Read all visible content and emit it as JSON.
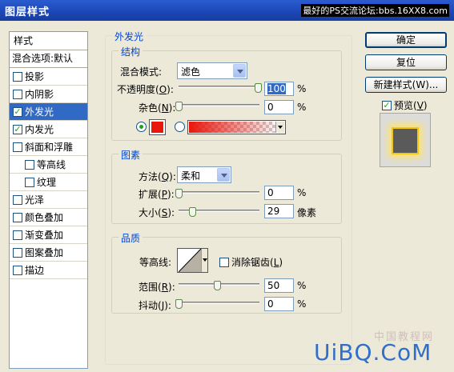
{
  "window": {
    "title": "图层样式",
    "watermark": "最好的PS交流论坛:bbs.16XX8.com"
  },
  "style_list": {
    "header": "样式",
    "blend_options": "混合选项:默认",
    "items": [
      {
        "label": "投影",
        "checked": false
      },
      {
        "label": "内阴影",
        "checked": false
      },
      {
        "label": "外发光",
        "checked": true,
        "selected": true
      },
      {
        "label": "内发光",
        "checked": true
      },
      {
        "label": "斜面和浮雕",
        "checked": false
      },
      {
        "label": "等高线",
        "checked": false,
        "sub": true
      },
      {
        "label": "纹理",
        "checked": false,
        "sub": true
      },
      {
        "label": "光泽",
        "checked": false
      },
      {
        "label": "颜色叠加",
        "checked": false
      },
      {
        "label": "渐变叠加",
        "checked": false
      },
      {
        "label": "图案叠加",
        "checked": false
      },
      {
        "label": "描边",
        "checked": false
      }
    ]
  },
  "panel": {
    "title": "外发光",
    "structure": {
      "title": "结构",
      "blend_mode_label": "混合模式:",
      "blend_mode_value": "滤色",
      "opacity_label": "不透明度(",
      "opacity_key": "O",
      "opacity_value": "100",
      "noise_label": "杂色(",
      "noise_key": "N",
      "noise_value": "0",
      "percent": "%",
      "color": "#e8160c"
    },
    "elements": {
      "title": "图素",
      "method_label": "方法(",
      "method_key": "Q",
      "method_value": "柔和",
      "spread_label": "扩展(",
      "spread_key": "P",
      "spread_value": "0",
      "size_label": "大小(",
      "size_key": "S",
      "size_value": "29",
      "size_unit": "像素"
    },
    "quality": {
      "title": "品质",
      "contour_label": "等高线:",
      "antialias_label": "消除锯齿(",
      "antialias_key": "L",
      "range_label": "范围(",
      "range_key": "R",
      "range_value": "50",
      "jitter_label": "抖动(",
      "jitter_key": "J",
      "jitter_value": "0"
    }
  },
  "buttons": {
    "ok": "确定",
    "reset": "复位",
    "new_style": "新建样式(W)...",
    "preview_label": "预览(",
    "preview_key": "V"
  },
  "footer": {
    "site": "UiBQ.CoM",
    "site_cn": "中国教程网"
  }
}
